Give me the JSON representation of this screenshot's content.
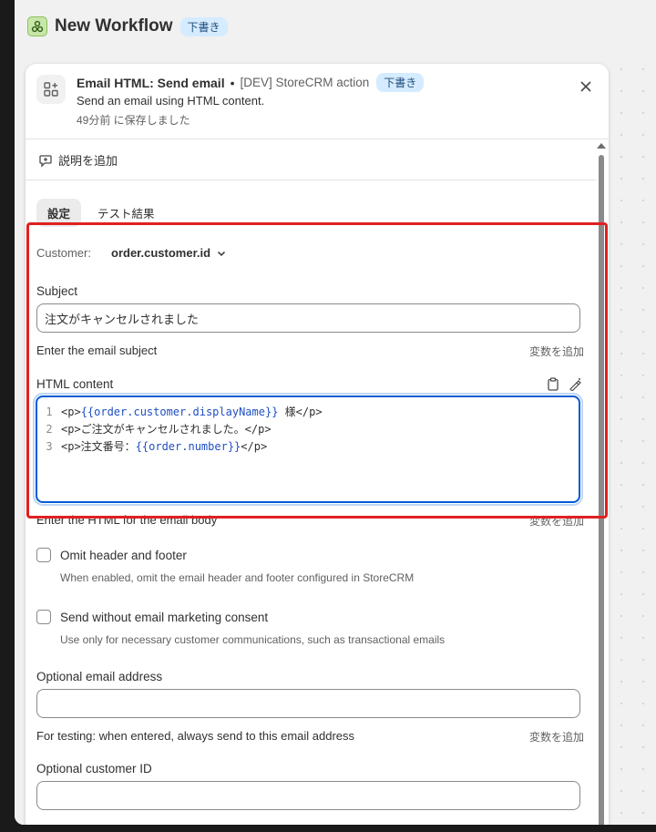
{
  "workflow": {
    "title": "New Workflow",
    "status_badge": "下書き"
  },
  "panel": {
    "action_title": "Email HTML: Send email",
    "app_name": "[DEV] StoreCRM action",
    "status_badge": "下書き",
    "description": "Send an email using HTML content.",
    "saved_text": "49分前 に保存しました",
    "add_description": "説明を追加"
  },
  "tabs": [
    {
      "label": "設定",
      "active": true
    },
    {
      "label": "テスト結果",
      "active": false
    }
  ],
  "customer": {
    "label": "Customer:",
    "value": "order.customer.id"
  },
  "subject": {
    "label": "Subject",
    "value": "注文がキャンセルされました",
    "help": "Enter the email subject",
    "add_variable": "変数を追加"
  },
  "html_content": {
    "label": "HTML content",
    "lines": [
      {
        "num": "1",
        "pre": "<p>",
        "var": "{{order.customer.displayName}}",
        "post": " 様</p>"
      },
      {
        "num": "2",
        "pre": "<p>ご注文がキャンセルされました。</p>",
        "var": "",
        "post": ""
      },
      {
        "num": "3",
        "pre": "<p>注文番号：",
        "var": "{{order.number}}",
        "post": "</p>"
      }
    ],
    "help": "Enter the HTML for the email body",
    "add_variable": "変数を追加"
  },
  "omit_header": {
    "label": "Omit header and footer",
    "help": "When enabled, omit the email header and footer configured in StoreCRM",
    "checked": false
  },
  "no_consent": {
    "label": "Send without email marketing consent",
    "help": "Use only for necessary customer communications, such as transactional emails",
    "checked": false
  },
  "optional_email": {
    "label": "Optional email address",
    "value": "",
    "help": "For testing: when entered, always send to this email address",
    "add_variable": "変数を追加"
  },
  "optional_customer": {
    "label": "Optional customer ID",
    "value": ""
  },
  "colors": {
    "accent": "#005bd3",
    "highlight": "#e02020",
    "badge_bg": "#d5ebff"
  }
}
